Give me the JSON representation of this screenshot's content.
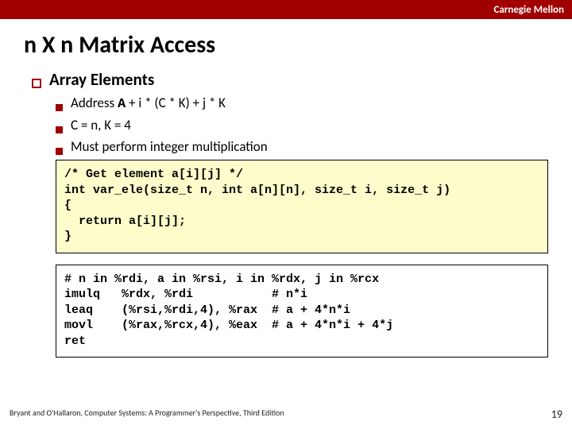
{
  "brand": "Carnegie Mellon",
  "title": "n X n Matrix Access",
  "section_heading": "Array Elements",
  "bullets": {
    "b1_prefix": "Address ",
    "b1_A": "A",
    "b1_rest": "  +  i * (C * K) +  j * K",
    "b2": "C = n, K = 4",
    "b3": "Must perform integer multiplication"
  },
  "code_c": "/* Get element a[i][j] */\nint var_ele(size_t n, int a[n][n], size_t i, size_t j)\n{\n  return a[i][j];\n}",
  "code_asm": "# n in %rdi, a in %rsi, i in %rdx, j in %rcx\nimulq   %rdx, %rdi           # n*i\nleaq    (%rsi,%rdi,4), %rax  # a + 4*n*i\nmovl    (%rax,%rcx,4), %eax  # a + 4*n*i + 4*j\nret",
  "footer_text": "Bryant and O'Hallaron, Computer Systems: A Programmer's Perspective, Third Edition",
  "page_number": "19"
}
